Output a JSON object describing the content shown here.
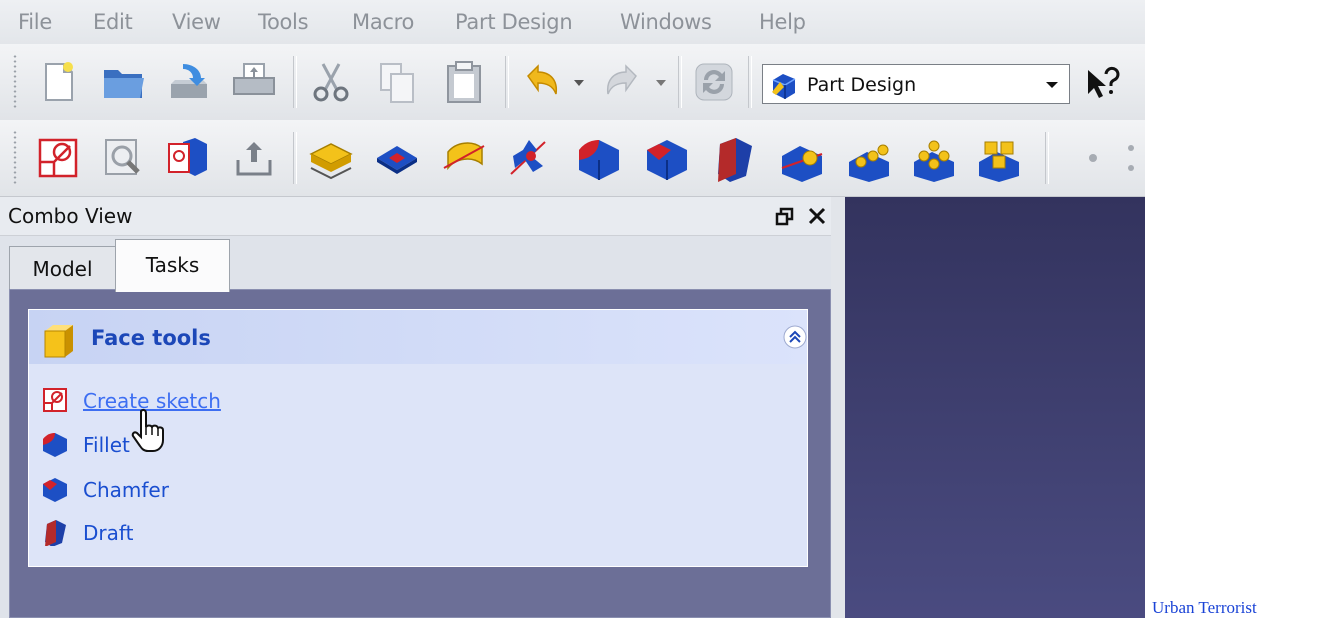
{
  "menu": [
    "File",
    "Edit",
    "View",
    "Tools",
    "Macro",
    "Part Design",
    "Windows",
    "Help"
  ],
  "workbench": {
    "selected": "Part Design"
  },
  "combo_view": {
    "title": "Combo View",
    "tabs": [
      "Model",
      "Tasks"
    ],
    "active_tab": "Tasks"
  },
  "task_panel": {
    "title": "Face tools",
    "items": [
      "Create sketch",
      "Fillet",
      "Chamfer",
      "Draft"
    ]
  },
  "caption": "Urban Terrorist",
  "colors": {
    "viewport": "#3d3e6e",
    "task_area": "#6c6f97",
    "panel": "#dde4f8",
    "link": "#1a4ed0",
    "title_blue": "#1c47b8"
  },
  "icons": {
    "toolbar1": [
      "new-file-icon",
      "open-folder-icon",
      "save-icon",
      "print-icon",
      "cut-icon",
      "copy-icon",
      "paste-icon",
      "undo-icon",
      "redo-icon",
      "refresh-icon"
    ],
    "toolbar2": [
      "sketch-icon",
      "view-sketch-icon",
      "map-sketch-icon",
      "leave-sketch-icon",
      "pad-icon",
      "pocket-icon",
      "revolution-icon",
      "groove-icon",
      "fillet-icon",
      "chamfer-icon",
      "draft-icon",
      "mirrored-icon",
      "linear-pattern-icon",
      "polar-pattern-icon",
      "multi-transform-icon"
    ]
  }
}
